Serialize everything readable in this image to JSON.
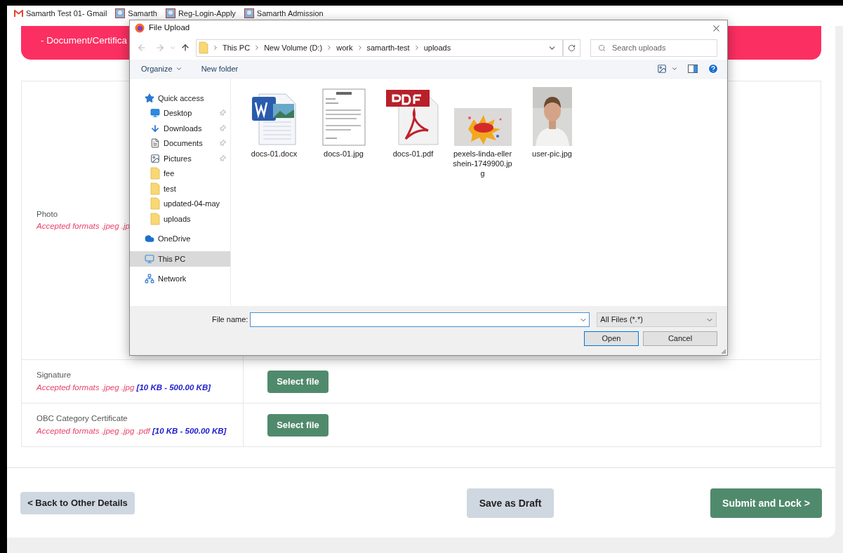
{
  "browser": {
    "bookmarks": [
      {
        "label": "Samarth Test 01- Gmail",
        "kind": "gmail"
      },
      {
        "label": "Samarth",
        "kind": "site"
      },
      {
        "label": "Reg-Login-Apply",
        "kind": "site"
      },
      {
        "label": "Samarth Admission",
        "kind": "site"
      }
    ]
  },
  "page": {
    "section_title": "- Document/Certifica",
    "documents": [
      {
        "name": "Photo",
        "formats": "Accepted formats .jpeg .jp",
        "kind": "tall"
      },
      {
        "name": "Signature",
        "formats": "Accepted formats .jpeg .jpg",
        "size": "[10 KB - 500.00 KB]",
        "button": "Select file",
        "kind": "row"
      },
      {
        "name": "OBC Category Certificate",
        "formats": "Accepted formats .jpeg .jpg .pdf",
        "size": "[10 KB - 500.00 KB]",
        "button": "Select file",
        "kind": "row"
      }
    ],
    "back_button": "< Back to Other Details",
    "draft_button": "Save as Draft",
    "submit_button": "Submit and Lock >"
  },
  "dialog": {
    "title": "File Upload",
    "breadcrumb": [
      "This PC",
      "New Volume (D:)",
      "work",
      "samarth-test",
      "uploads"
    ],
    "search_placeholder": "Search uploads",
    "toolbar": [
      "Organize",
      "New folder"
    ],
    "nav": [
      {
        "label": "Quick access",
        "kind": "quick",
        "selected": false,
        "children": [
          {
            "label": "Desktop",
            "kind": "desktop",
            "pinned": true,
            "selected": false
          },
          {
            "label": "Downloads",
            "kind": "downloads",
            "pinned": true,
            "selected": false
          },
          {
            "label": "Documents",
            "kind": "documents",
            "pinned": true,
            "selected": false
          },
          {
            "label": "Pictures",
            "kind": "pictures",
            "pinned": true,
            "selected": false
          },
          {
            "label": "fee",
            "kind": "folder",
            "pinned": false,
            "selected": false
          },
          {
            "label": "test",
            "kind": "folder",
            "pinned": false,
            "selected": false
          },
          {
            "label": "updated-04-may",
            "kind": "folder",
            "pinned": false,
            "selected": false
          },
          {
            "label": "uploads",
            "kind": "folder",
            "pinned": false,
            "selected": false
          }
        ]
      },
      {
        "label": "OneDrive",
        "kind": "onedrive",
        "selected": false
      },
      {
        "label": "This PC",
        "kind": "pc",
        "selected": true
      },
      {
        "label": "Network",
        "kind": "network",
        "selected": false
      }
    ],
    "files": [
      {
        "name": "docs-01.docx",
        "kind": "word"
      },
      {
        "name": "docs-01.jpg",
        "kind": "page"
      },
      {
        "name": "docs-01.pdf",
        "kind": "pdf"
      },
      {
        "name": "pexels-linda-ellershein-1749900.jpg"
      },
      {
        "name": "user-pic.jpg",
        "kind": "portrait"
      }
    ],
    "file_name_label": "File name:",
    "file_type": "All Files (*.*)",
    "open_button": "Open",
    "cancel_button": "Cancel"
  }
}
